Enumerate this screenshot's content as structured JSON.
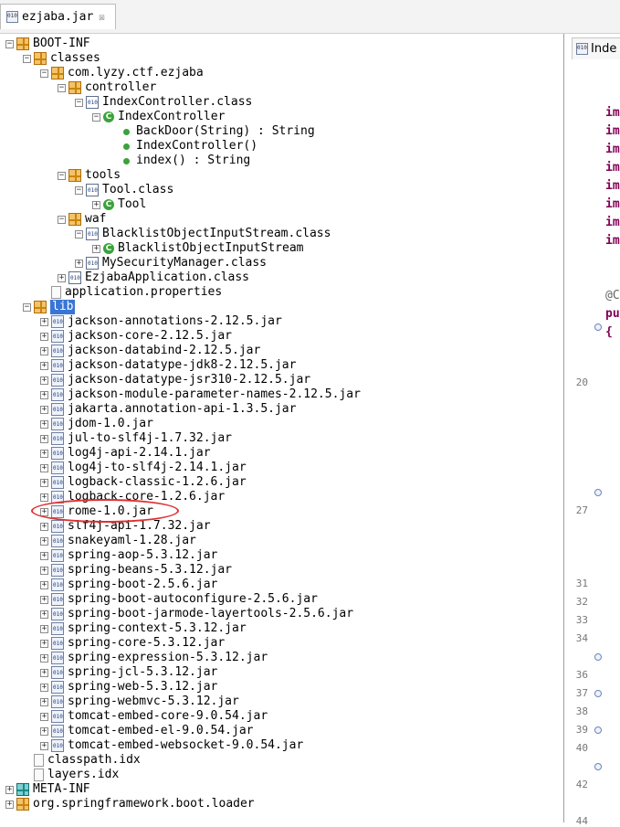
{
  "tab": {
    "title": "ezjaba.jar",
    "close_glyph": "☒"
  },
  "tree": [
    {
      "label": "BOOT-INF",
      "depth": 0,
      "icon": "package-icon",
      "expander": "minus"
    },
    {
      "label": "classes",
      "depth": 1,
      "icon": "package-icon",
      "expander": "minus"
    },
    {
      "label": "com.lyzy.ctf.ezjaba",
      "depth": 2,
      "icon": "package-icon",
      "expander": "minus"
    },
    {
      "label": "controller",
      "depth": 3,
      "icon": "package-icon",
      "expander": "minus"
    },
    {
      "label": "IndexController.class",
      "depth": 4,
      "icon": "class-file-icon",
      "expander": "minus"
    },
    {
      "label": "IndexController",
      "depth": 5,
      "icon": "class-icon",
      "expander": "minus"
    },
    {
      "label": "BackDoor(String) : String",
      "depth": 6,
      "icon": "method-icon",
      "expander": "none"
    },
    {
      "label": "IndexController()",
      "depth": 6,
      "icon": "method-icon",
      "expander": "none"
    },
    {
      "label": "index() : String",
      "depth": 6,
      "icon": "method-icon",
      "expander": "none"
    },
    {
      "label": "tools",
      "depth": 3,
      "icon": "package-icon",
      "expander": "minus"
    },
    {
      "label": "Tool.class",
      "depth": 4,
      "icon": "class-file-icon",
      "expander": "minus"
    },
    {
      "label": "Tool",
      "depth": 5,
      "icon": "class-icon",
      "expander": "plus"
    },
    {
      "label": "waf",
      "depth": 3,
      "icon": "package-icon",
      "expander": "minus"
    },
    {
      "label": "BlacklistObjectInputStream.class",
      "depth": 4,
      "icon": "class-file-icon",
      "expander": "minus"
    },
    {
      "label": "BlacklistObjectInputStream",
      "depth": 5,
      "icon": "class-icon",
      "expander": "plus"
    },
    {
      "label": "MySecurityManager.class",
      "depth": 4,
      "icon": "class-file-icon",
      "expander": "plus"
    },
    {
      "label": "EzjabaApplication.class",
      "depth": 3,
      "icon": "class-file-icon",
      "expander": "plus"
    },
    {
      "label": "application.properties",
      "depth": 2,
      "icon": "file-icon",
      "expander": "none"
    },
    {
      "label": "lib",
      "depth": 1,
      "icon": "package-icon",
      "expander": "minus",
      "selected": true
    },
    {
      "label": "jackson-annotations-2.12.5.jar",
      "depth": 2,
      "icon": "jar-icon",
      "expander": "plus"
    },
    {
      "label": "jackson-core-2.12.5.jar",
      "depth": 2,
      "icon": "jar-icon",
      "expander": "plus"
    },
    {
      "label": "jackson-databind-2.12.5.jar",
      "depth": 2,
      "icon": "jar-icon",
      "expander": "plus"
    },
    {
      "label": "jackson-datatype-jdk8-2.12.5.jar",
      "depth": 2,
      "icon": "jar-icon",
      "expander": "plus"
    },
    {
      "label": "jackson-datatype-jsr310-2.12.5.jar",
      "depth": 2,
      "icon": "jar-icon",
      "expander": "plus"
    },
    {
      "label": "jackson-module-parameter-names-2.12.5.jar",
      "depth": 2,
      "icon": "jar-icon",
      "expander": "plus"
    },
    {
      "label": "jakarta.annotation-api-1.3.5.jar",
      "depth": 2,
      "icon": "jar-icon",
      "expander": "plus"
    },
    {
      "label": "jdom-1.0.jar",
      "depth": 2,
      "icon": "jar-icon",
      "expander": "plus"
    },
    {
      "label": "jul-to-slf4j-1.7.32.jar",
      "depth": 2,
      "icon": "jar-icon",
      "expander": "plus"
    },
    {
      "label": "log4j-api-2.14.1.jar",
      "depth": 2,
      "icon": "jar-icon",
      "expander": "plus"
    },
    {
      "label": "log4j-to-slf4j-2.14.1.jar",
      "depth": 2,
      "icon": "jar-icon",
      "expander": "plus"
    },
    {
      "label": "logback-classic-1.2.6.jar",
      "depth": 2,
      "icon": "jar-icon",
      "expander": "plus"
    },
    {
      "label": "logback-core-1.2.6.jar",
      "depth": 2,
      "icon": "jar-icon",
      "expander": "plus"
    },
    {
      "label": "rome-1.0.jar",
      "depth": 2,
      "icon": "jar-icon",
      "expander": "plus",
      "highlighted": true
    },
    {
      "label": "slf4j-api-1.7.32.jar",
      "depth": 2,
      "icon": "jar-icon",
      "expander": "plus"
    },
    {
      "label": "snakeyaml-1.28.jar",
      "depth": 2,
      "icon": "jar-icon",
      "expander": "plus"
    },
    {
      "label": "spring-aop-5.3.12.jar",
      "depth": 2,
      "icon": "jar-icon",
      "expander": "plus"
    },
    {
      "label": "spring-beans-5.3.12.jar",
      "depth": 2,
      "icon": "jar-icon",
      "expander": "plus"
    },
    {
      "label": "spring-boot-2.5.6.jar",
      "depth": 2,
      "icon": "jar-icon",
      "expander": "plus"
    },
    {
      "label": "spring-boot-autoconfigure-2.5.6.jar",
      "depth": 2,
      "icon": "jar-icon",
      "expander": "plus"
    },
    {
      "label": "spring-boot-jarmode-layertools-2.5.6.jar",
      "depth": 2,
      "icon": "jar-icon",
      "expander": "plus"
    },
    {
      "label": "spring-context-5.3.12.jar",
      "depth": 2,
      "icon": "jar-icon",
      "expander": "plus"
    },
    {
      "label": "spring-core-5.3.12.jar",
      "depth": 2,
      "icon": "jar-icon",
      "expander": "plus"
    },
    {
      "label": "spring-expression-5.3.12.jar",
      "depth": 2,
      "icon": "jar-icon",
      "expander": "plus"
    },
    {
      "label": "spring-jcl-5.3.12.jar",
      "depth": 2,
      "icon": "jar-icon",
      "expander": "plus"
    },
    {
      "label": "spring-web-5.3.12.jar",
      "depth": 2,
      "icon": "jar-icon",
      "expander": "plus"
    },
    {
      "label": "spring-webmvc-5.3.12.jar",
      "depth": 2,
      "icon": "jar-icon",
      "expander": "plus"
    },
    {
      "label": "tomcat-embed-core-9.0.54.jar",
      "depth": 2,
      "icon": "jar-icon",
      "expander": "plus"
    },
    {
      "label": "tomcat-embed-el-9.0.54.jar",
      "depth": 2,
      "icon": "jar-icon",
      "expander": "plus"
    },
    {
      "label": "tomcat-embed-websocket-9.0.54.jar",
      "depth": 2,
      "icon": "jar-icon",
      "expander": "plus"
    },
    {
      "label": "classpath.idx",
      "depth": 1,
      "icon": "file-icon",
      "expander": "none"
    },
    {
      "label": "layers.idx",
      "depth": 1,
      "icon": "file-icon",
      "expander": "none"
    },
    {
      "label": "META-INF",
      "depth": 0,
      "icon": "package-teal-icon",
      "expander": "plus"
    },
    {
      "label": "org.springframework.boot.loader",
      "depth": 0,
      "icon": "package-icon",
      "expander": "plus"
    }
  ],
  "editor": {
    "tab_label": "Inde",
    "code_lines": [
      "im",
      "im",
      "im",
      "im",
      "im",
      "im",
      "im",
      "im",
      "",
      "",
      "@C",
      "pu",
      "{"
    ],
    "line_numbers": [
      "20",
      "27",
      "31",
      "32",
      "33",
      "34",
      "36",
      "37",
      "38",
      "39",
      "40",
      "42",
      "44"
    ]
  }
}
